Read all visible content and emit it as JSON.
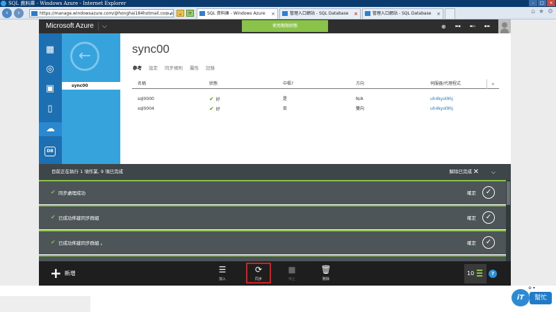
{
  "window": {
    "title": "SQL 資料庫 - Windows Azure - Internet Explorer"
  },
  "browser": {
    "address": "https://manage.windowsazure.com/@honghai184hotmail.com.o",
    "tabs": [
      {
        "label": "SQL 資料庫 - Windows Azure",
        "active": true
      },
      {
        "label": "管理入口網站 - SQL Database",
        "active": false
      },
      {
        "label": "管理入口網站 - SQL Database",
        "active": false
      }
    ]
  },
  "azure": {
    "brand": "Microsoft Azure",
    "trial_label": "使用期限狀態"
  },
  "subnav": {
    "selected": "sync00"
  },
  "page": {
    "title": "sync00",
    "tabs": [
      "參考",
      "設定",
      "同步規則",
      "屬性",
      "記錄"
    ],
    "active_tab": "參考"
  },
  "table": {
    "headers": [
      "名稱",
      "狀態",
      "中樞?",
      "方向",
      "伺服器/代理程式"
    ],
    "rows": [
      {
        "name": "sql0000",
        "status": "好",
        "hub": "是",
        "direction": "N/A",
        "server": "uh4kyol9hj"
      },
      {
        "name": "sql0004",
        "status": "好",
        "hub": "否",
        "direction": "雙向",
        "server": "uh4kyol9hj"
      }
    ]
  },
  "status_panel": {
    "message": "目前正在執行 1 項作業, 9 項已完成",
    "dismiss_label": "解除已完成",
    "notifications": [
      {
        "text": "同步處理成功",
        "ok": "確定"
      },
      {
        "text": "已成功佈建同步群組",
        "ok": "確定"
      },
      {
        "text": "已成功佈建同步群組 。",
        "ok": "確定"
      }
    ]
  },
  "command_bar": {
    "new_label": "新增",
    "commands": [
      {
        "label": "加入",
        "icon": "add-list-icon",
        "enabled": true
      },
      {
        "label": "同步",
        "icon": "sync-icon",
        "enabled": true
      },
      {
        "label": "停止",
        "icon": "stop-icon",
        "enabled": false
      },
      {
        "label": "刪除",
        "icon": "trash-icon",
        "enabled": true
      }
    ],
    "notification_count": "10",
    "help": "?"
  },
  "watermark": {
    "bubble": "iT",
    "text": "幫忙"
  },
  "colors": {
    "azure_blue": "#1c6fb0",
    "azure_light_blue": "#36a3dc",
    "success_green": "#8bc34a",
    "highlight_red": "#d6201f"
  }
}
